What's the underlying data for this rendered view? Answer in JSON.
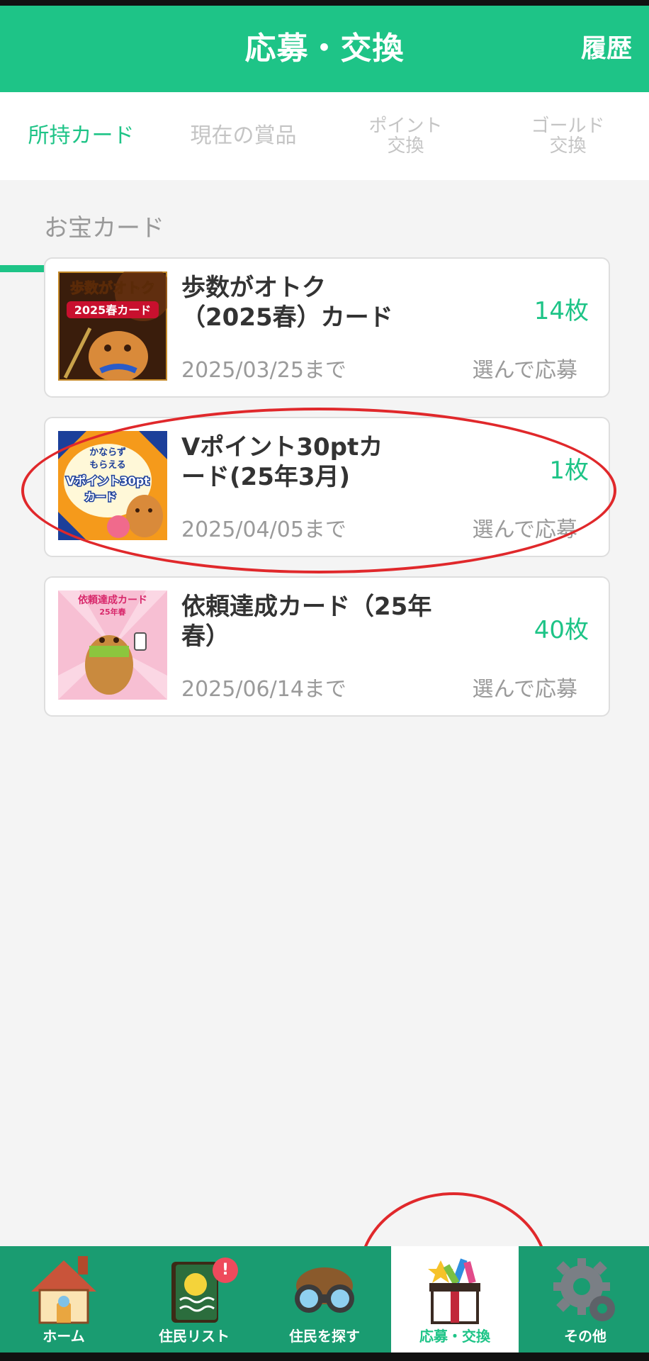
{
  "header": {
    "title": "応募・交換",
    "history_label": "履歴"
  },
  "tabs": [
    {
      "label": "所持カード",
      "active": true
    },
    {
      "label": "現在の賞品",
      "active": false
    },
    {
      "label": "ポイント\n交換",
      "active": false
    },
    {
      "label": "ゴールド\n交換",
      "active": false
    }
  ],
  "section_title": "お宝カード",
  "cards": [
    {
      "name": "歩数がオトク（2025春）カード",
      "count": "14枚",
      "deadline": "2025/03/25まで",
      "action": "選んで応募",
      "thumb_text": [
        "歩数がオトク",
        "2025春カード"
      ]
    },
    {
      "name": "Vポイント30ptカード(25年3月)",
      "count": "1枚",
      "deadline": "2025/04/05まで",
      "action": "選んで応募",
      "thumb_text": [
        "かならず",
        "もらえる",
        "Vポイント30pt",
        "カード"
      ]
    },
    {
      "name": "依頼達成カード（25年春）",
      "count": "40枚",
      "deadline": "2025/06/14まで",
      "action": "選んで応募",
      "thumb_text": [
        "依頼達成カード",
        "25年春"
      ]
    }
  ],
  "bottom_nav": [
    {
      "label": "ホーム",
      "icon": "house-icon"
    },
    {
      "label": "住民リスト",
      "icon": "notebook-icon",
      "badge": "!"
    },
    {
      "label": "住民を探す",
      "icon": "binoculars-icon"
    },
    {
      "label": "応募・交換",
      "icon": "gift-box-icon",
      "active": true
    },
    {
      "label": "その他",
      "icon": "gear-icon"
    }
  ],
  "colors": {
    "brand": "#1ec487",
    "annotation": "#e0282b"
  }
}
